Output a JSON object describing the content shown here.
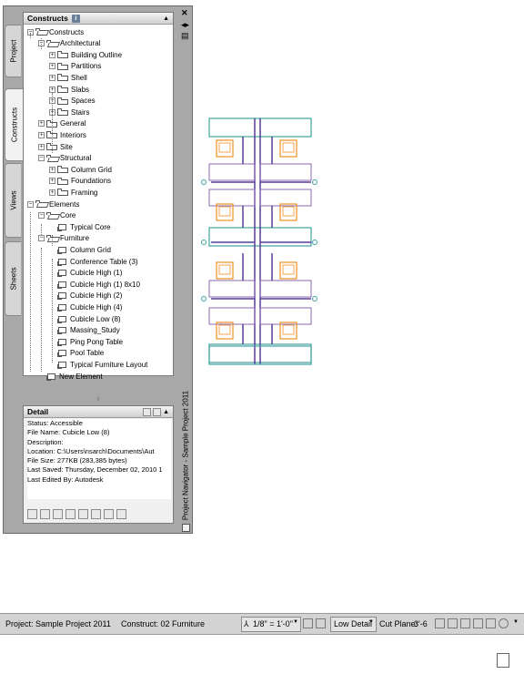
{
  "side_tabs": {
    "project": "Project",
    "constructs": "Constructs",
    "views": "Views",
    "sheets": "Sheets"
  },
  "tree_panel": {
    "title": "Constructs",
    "info_badge": "i",
    "nodes": [
      {
        "label": "Constructs",
        "icon": "folder-open-icon",
        "expander": "−"
      },
      {
        "label": "Architectural",
        "icon": "folder-open-icon",
        "expander": "−"
      },
      {
        "label": "Building Outline",
        "icon": "folder-icon",
        "expander": "+"
      },
      {
        "label": "Partitions",
        "icon": "folder-icon",
        "expander": "+"
      },
      {
        "label": "Shell",
        "icon": "folder-icon",
        "expander": "+"
      },
      {
        "label": "Slabs",
        "icon": "folder-icon",
        "expander": "+"
      },
      {
        "label": "Spaces",
        "icon": "folder-icon",
        "expander": "+"
      },
      {
        "label": "Stairs",
        "icon": "folder-icon",
        "expander": "+"
      },
      {
        "label": "General",
        "icon": "folder-icon",
        "expander": "+"
      },
      {
        "label": "Interiors",
        "icon": "folder-icon",
        "expander": "+"
      },
      {
        "label": "Site",
        "icon": "folder-icon",
        "expander": "+"
      },
      {
        "label": "Structural",
        "icon": "folder-open-icon",
        "expander": "−"
      },
      {
        "label": "Column Grid",
        "icon": "folder-icon",
        "expander": "+"
      },
      {
        "label": "Foundations",
        "icon": "folder-icon",
        "expander": "+"
      },
      {
        "label": "Framing",
        "icon": "folder-icon",
        "expander": "+"
      },
      {
        "label": "Elements",
        "icon": "folder-open-icon",
        "expander": "−"
      },
      {
        "label": "Core",
        "icon": "folder-open-icon",
        "expander": "−"
      },
      {
        "label": "Typical Core",
        "icon": "drawing-icon",
        "expander": ""
      },
      {
        "label": "Furniture",
        "icon": "folder-open-icon",
        "expander": "−"
      },
      {
        "label": "Column Grid",
        "icon": "drawing-icon",
        "expander": ""
      },
      {
        "label": "Conference Table (3)",
        "icon": "drawing-icon",
        "expander": ""
      },
      {
        "label": "Cubicle High (1)",
        "icon": "drawing-icon",
        "expander": ""
      },
      {
        "label": "Cubicle High (1) 8x10",
        "icon": "drawing-icon",
        "expander": ""
      },
      {
        "label": "Cubicle High (2)",
        "icon": "drawing-icon",
        "expander": ""
      },
      {
        "label": "Cubicle High (4)",
        "icon": "drawing-icon",
        "expander": ""
      },
      {
        "label": "Cubicle Low (8)",
        "icon": "drawing-icon",
        "expander": ""
      },
      {
        "label": "Massing_Study",
        "icon": "drawing-icon",
        "expander": ""
      },
      {
        "label": "Ping Pong Table",
        "icon": "drawing-icon",
        "expander": ""
      },
      {
        "label": "Pool Table",
        "icon": "drawing-icon",
        "expander": ""
      },
      {
        "label": "Typical Furniture Layout",
        "icon": "drawing-icon",
        "expander": ""
      },
      {
        "label": "New Element",
        "icon": "drawing-icon",
        "expander": ""
      }
    ]
  },
  "detail_panel": {
    "title": "Detail",
    "lines": [
      "Status: Accessible",
      "File Name: Cubicle Low (8)",
      "Description:",
      "Location: C:\\Users\\nsarch\\Documents\\Aut",
      "File Size: 277KB (283,385 bytes)",
      "Last Saved: Thursday, December 02, 2010 1",
      "Last Edited By: Autodesk"
    ],
    "tools": [
      "add-construct-icon",
      "add-element-icon",
      "copy-icon",
      "clipboard-icon",
      "repath-icon",
      "properties-icon",
      "refresh-icon",
      "xref-icon"
    ]
  },
  "right_strip": {
    "close": "✕",
    "nav_title": "Project Navigator - Sample Project 2011"
  },
  "status_bar": {
    "project": "Project: Sample Project 2011",
    "construct": "Construct: 02 Furniture",
    "scale": "1/8\" = 1'-0\"",
    "detail_level": "Low Detail",
    "cut_plane_label": "Cut Plane:",
    "cut_plane_value": "3'-6"
  },
  "colors": {
    "partition_purple": "#5a3c96",
    "chair_orange": "#f09020",
    "desk_violet": "#8a6ab0",
    "grid_teal": "#40a0a0"
  }
}
